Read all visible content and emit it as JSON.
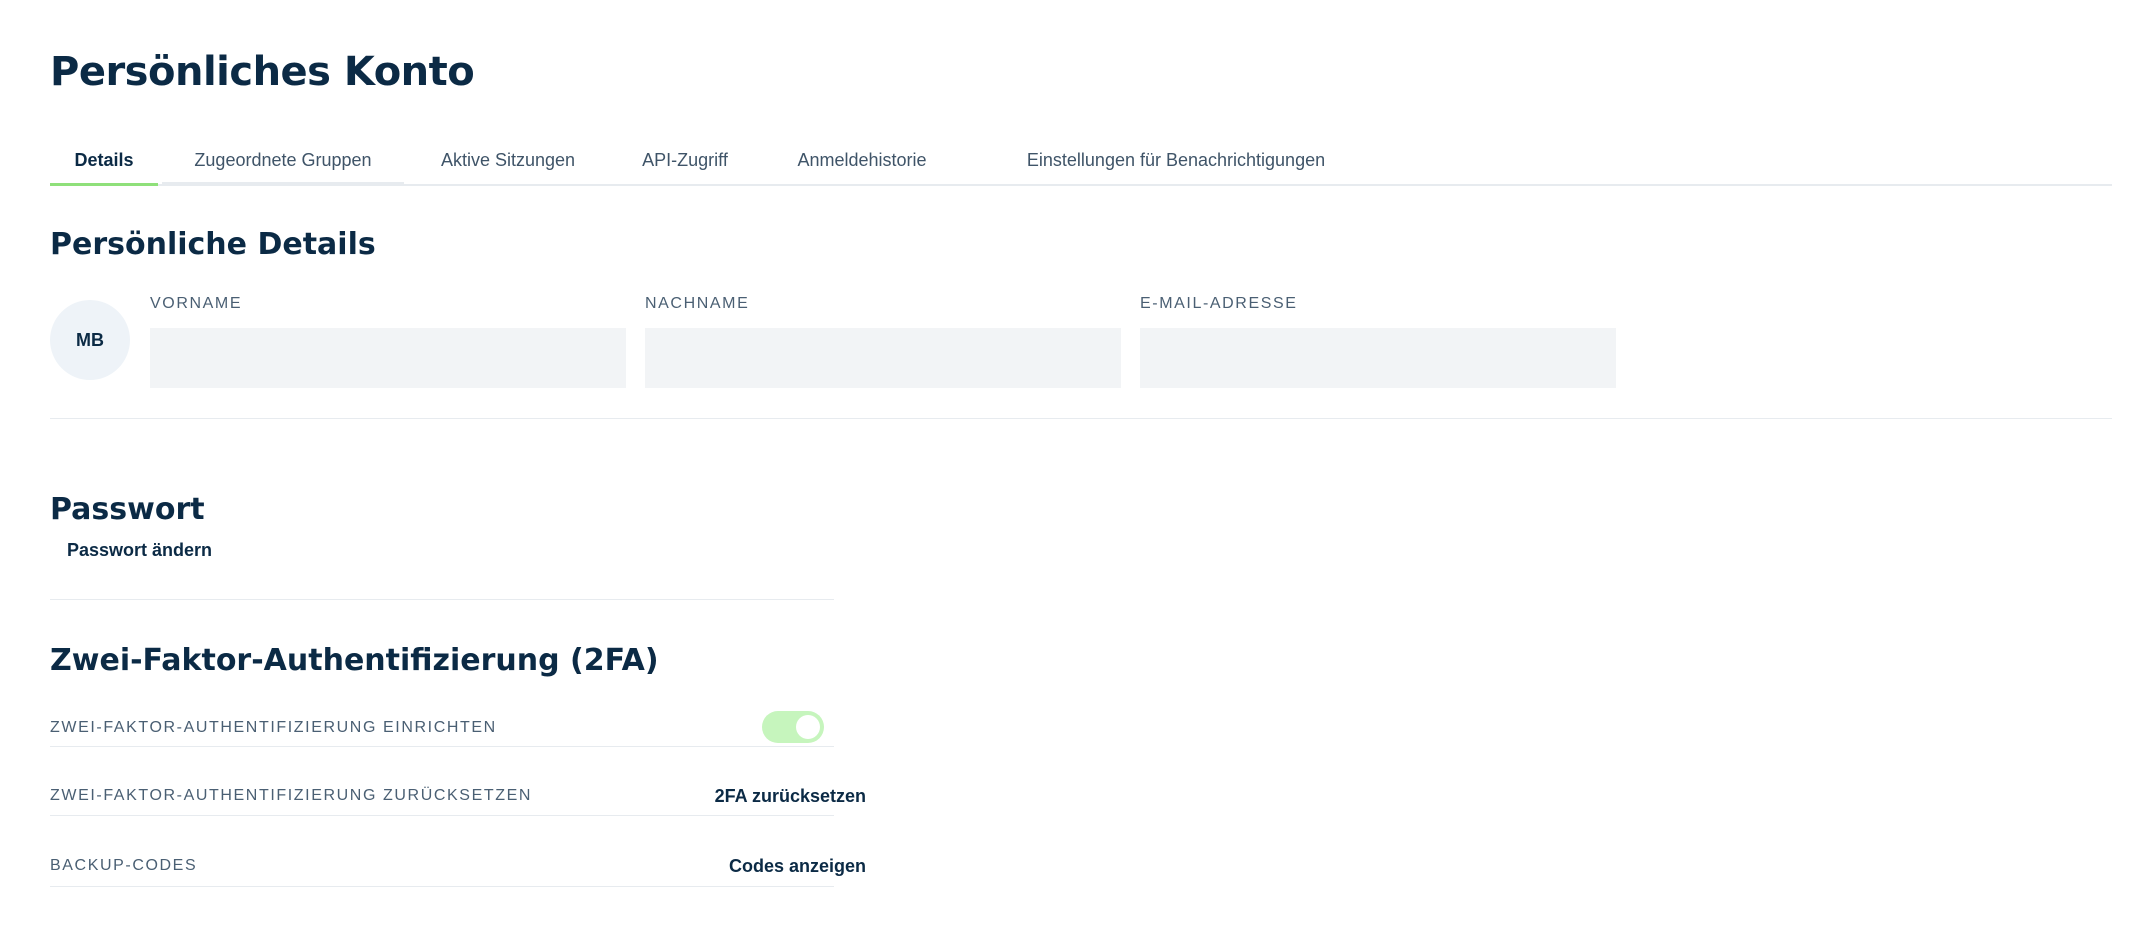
{
  "page": {
    "title": "Persönliches Konto"
  },
  "tabs": [
    {
      "label": "Details",
      "active": true
    },
    {
      "label": "Zugeordnete Gruppen",
      "active": false
    },
    {
      "label": "Aktive Sitzungen",
      "active": false
    },
    {
      "label": "API-Zugriff",
      "active": false
    },
    {
      "label": "Anmeldehistorie",
      "active": false
    },
    {
      "label": "Einstellungen für Benachrichtigungen",
      "active": false
    }
  ],
  "personal_details": {
    "title": "Persönliche Details",
    "avatar_initials": "MB",
    "fields": [
      {
        "label": "VORNAME",
        "value": ""
      },
      {
        "label": "NACHNAME",
        "value": ""
      },
      {
        "label": "E-MAIL-ADRESSE",
        "value": ""
      }
    ]
  },
  "password": {
    "title": "Passwort",
    "change_label": "Passwort ändern"
  },
  "two_factor": {
    "title": "Zwei-Faktor-Authentifizierung (2FA)",
    "rows": [
      {
        "label": "ZWEI-FAKTOR-AUTHENTIFIZIERUNG EINRICHTEN",
        "control": "toggle",
        "enabled": true
      },
      {
        "label": "ZWEI-FAKTOR-AUTHENTIFIZIERUNG ZURÜCKSETZEN",
        "action_label": "2FA zurücksetzen"
      },
      {
        "label": "BACKUP-CODES",
        "action_label": "Codes anzeigen"
      }
    ]
  },
  "colors": {
    "primary_text": "#0b2a45",
    "tab_active_underline": "#8fe07a",
    "toggle_on": "#c6f5bd",
    "input_background": "#f2f4f6",
    "divider": "#e7ebef"
  }
}
